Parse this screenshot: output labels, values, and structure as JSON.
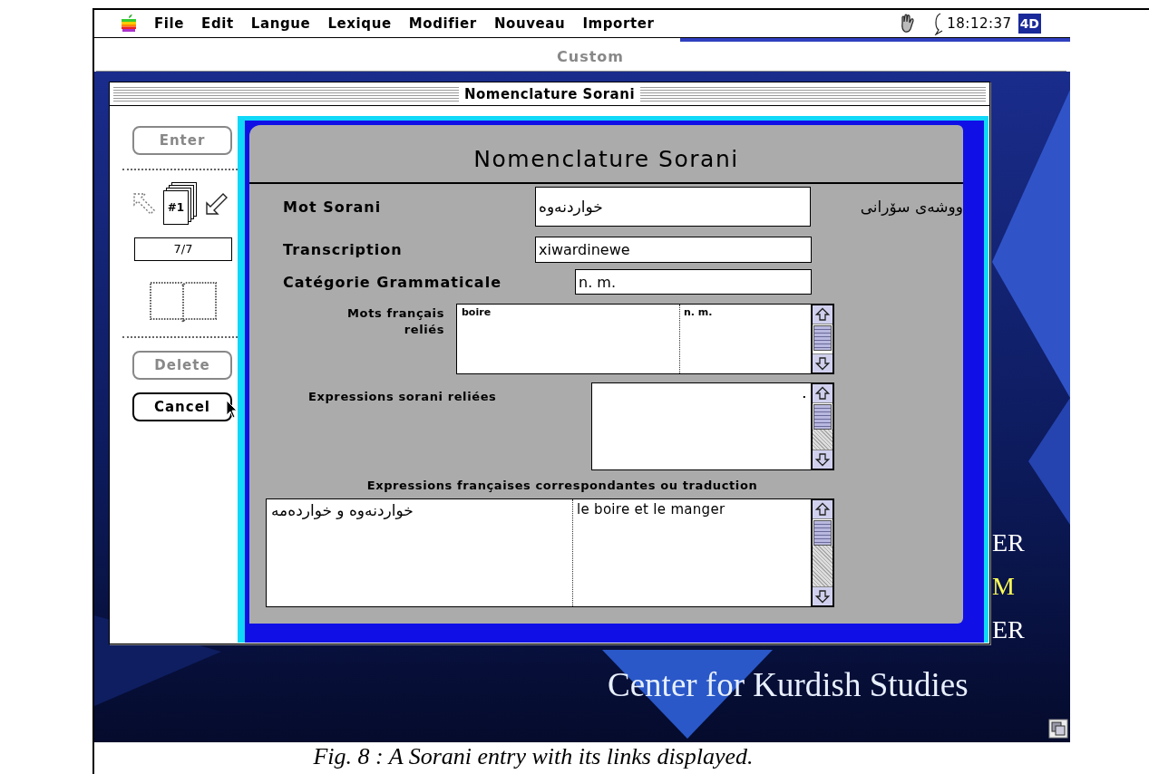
{
  "menu_bar": {
    "items": [
      {
        "label": "File"
      },
      {
        "label": "Edit"
      },
      {
        "label": "Langue"
      },
      {
        "label": "Lexique"
      },
      {
        "label": "Modifier"
      },
      {
        "label": "Nouveau"
      },
      {
        "label": "Importer"
      }
    ],
    "clock": "18:12:37",
    "app_badge": "4D"
  },
  "background_window": {
    "title": "Custom"
  },
  "window": {
    "title": "Nomenclature Sorani"
  },
  "sidebar": {
    "enter_button": {
      "label": "Enter",
      "disabled": true
    },
    "record_badge": "#1",
    "record_counter": "7/7",
    "delete_button": {
      "label": "Delete",
      "disabled": true
    },
    "cancel_button": {
      "label": "Cancel",
      "disabled": false
    }
  },
  "form": {
    "heading": "Nomenclature Sorani",
    "mot_sorani": {
      "label": "Mot Sorani",
      "value": "خواردنەوە",
      "label_sorani": "ووشەی سۆرانی"
    },
    "transcription": {
      "label": "Transcription",
      "value": "xiwardinewe"
    },
    "categorie": {
      "label": "Catégorie Grammaticale",
      "value": "n. m."
    },
    "mots_francais": {
      "label": "Mots français reliés",
      "rows": [
        {
          "cells": [
            "boire",
            "n. m."
          ]
        }
      ]
    },
    "expressions_sorani": {
      "label": "Expressions sorani reliées",
      "rows": [
        {
          "cells": [
            "."
          ]
        }
      ]
    },
    "expressions_francaises": {
      "label": "Expressions françaises correspondantes ou traduction",
      "rows": [
        {
          "cells": [
            "خواردنەوە و خواردەمە",
            "le boire et le manger"
          ]
        }
      ]
    }
  },
  "desktop": {
    "fragments": [
      {
        "text": "ER",
        "color": "#ffffff"
      },
      {
        "text": "M",
        "color": "#ffff55"
      },
      {
        "text": "ER",
        "color": "#ffffff"
      }
    ],
    "banner": "Center for Kurdish Studies"
  },
  "caption": "Fig. 8 : A Sorani entry with its links displayed."
}
